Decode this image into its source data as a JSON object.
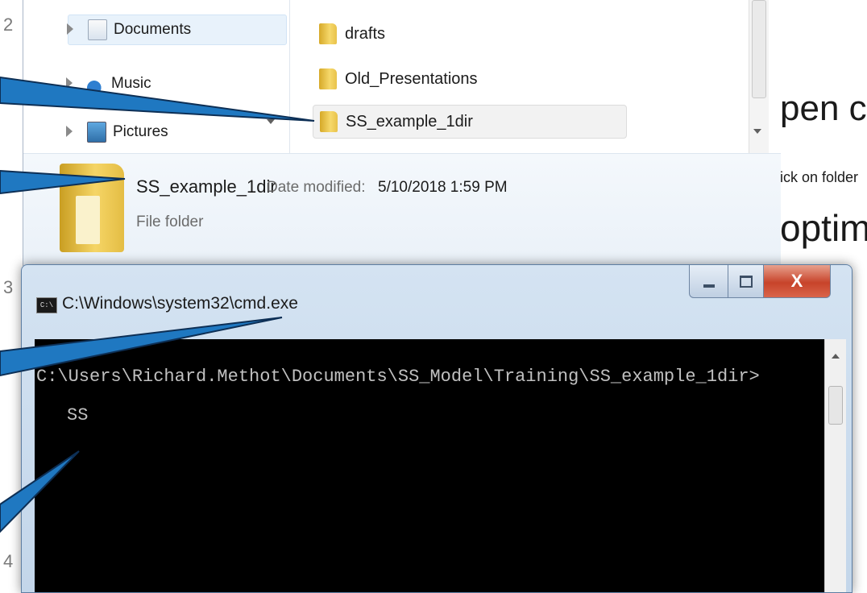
{
  "slide": {
    "numbers": [
      "2",
      "3",
      "4"
    ],
    "bg_text": {
      "line1": "pen co",
      "line2": "ick on folder",
      "line3": "optim"
    }
  },
  "explorer": {
    "nav_items": [
      {
        "label": "Documents",
        "icon": "documents-icon"
      },
      {
        "label": "Music",
        "icon": "music-icon"
      },
      {
        "label": "Pictures",
        "icon": "pictures-icon"
      }
    ],
    "files": [
      {
        "label": "drafts",
        "icon": "folder-icon"
      },
      {
        "label": "Old_Presentations",
        "icon": "folder-icon"
      },
      {
        "label": "SS_example_1dir",
        "icon": "folder-icon",
        "selected": true
      }
    ],
    "details": {
      "name": "SS_example_1dir",
      "date_label": "Date modified:",
      "date_value": "5/10/2018 1:59 PM",
      "type": "File folder"
    }
  },
  "cmd": {
    "title": "C:\\Windows\\system32\\cmd.exe",
    "icon_text": "C:\\",
    "close_label": "X",
    "lines": [
      "C:\\Users\\Richard.Methot\\Documents\\SS_Model\\Training\\SS_example_1dir>",
      "SS"
    ]
  },
  "colors": {
    "callout_fill": "#1f78c1",
    "callout_stroke": "#0d2f55",
    "console_bg": "#000000",
    "console_text": "#c0c0c0"
  }
}
